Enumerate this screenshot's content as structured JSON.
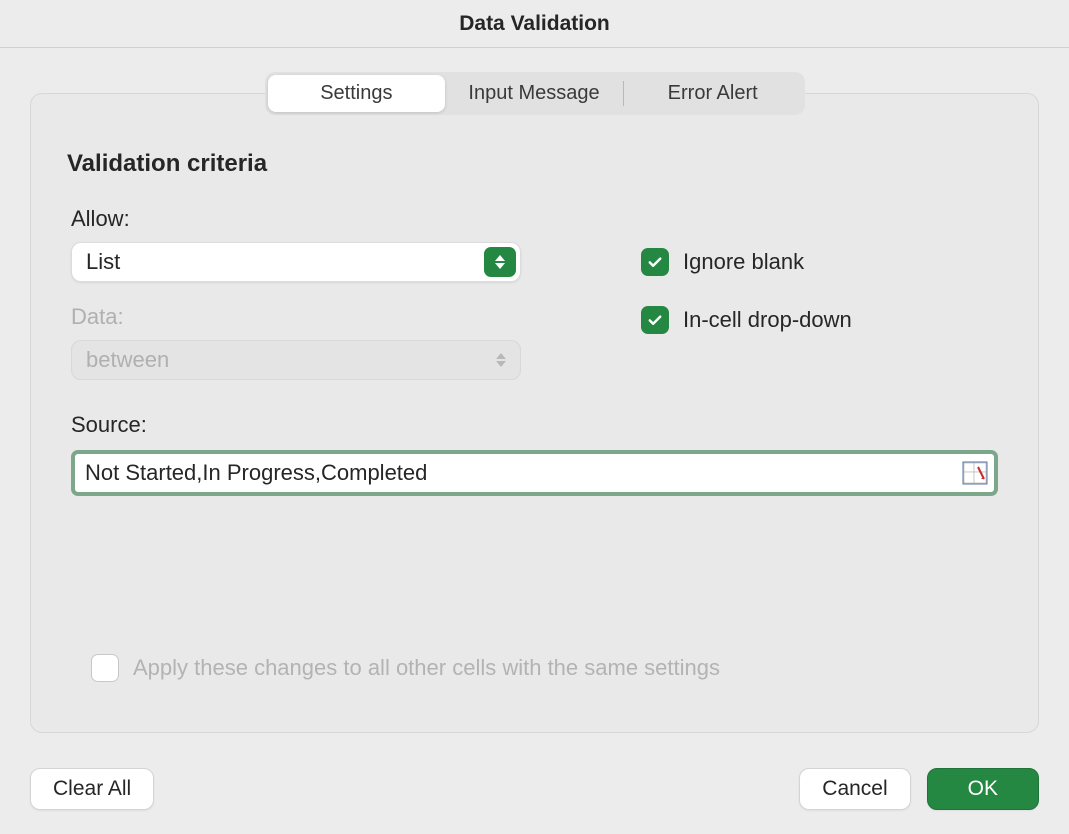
{
  "dialog": {
    "title": "Data Validation"
  },
  "tabs": {
    "settings": "Settings",
    "input_message": "Input Message",
    "error_alert": "Error Alert"
  },
  "section": {
    "title": "Validation criteria"
  },
  "allow": {
    "label": "Allow:",
    "value": "List"
  },
  "data": {
    "label": "Data:",
    "value": "between"
  },
  "source": {
    "label": "Source:",
    "value": "Not Started,In Progress,Completed"
  },
  "options": {
    "ignore_blank": "Ignore blank",
    "in_cell_dropdown": "In-cell drop-down",
    "apply_all": "Apply these changes to all other cells with the same settings"
  },
  "buttons": {
    "clear_all": "Clear All",
    "cancel": "Cancel",
    "ok": "OK"
  }
}
